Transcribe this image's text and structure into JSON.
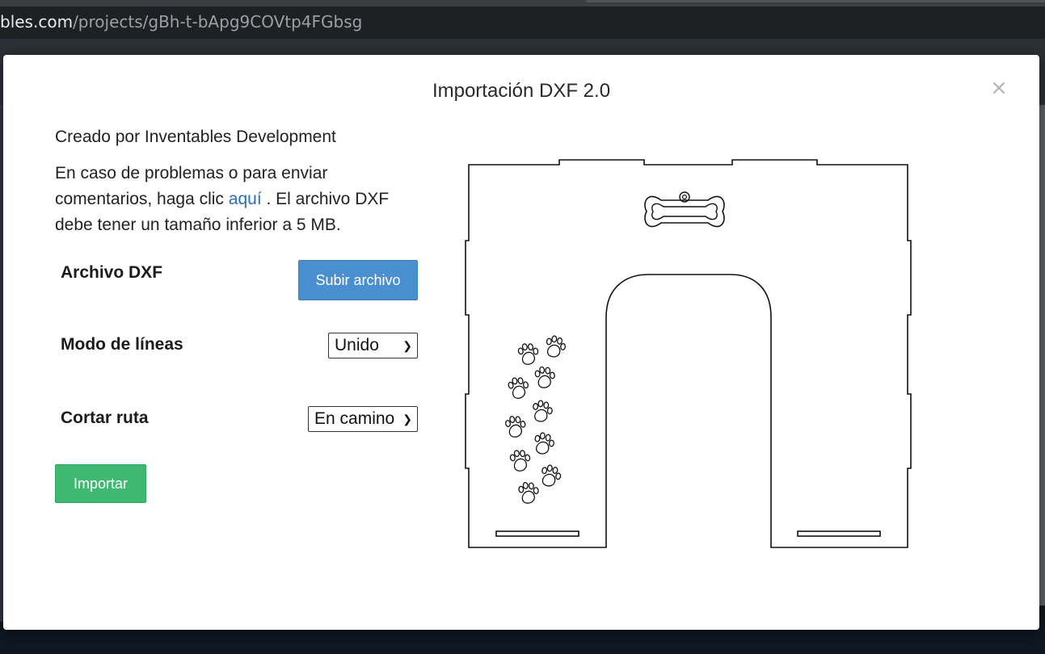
{
  "browser": {
    "url_host": "bles.com",
    "url_path": "/projects/gBh-t-bApg9COVtp4FGbsg"
  },
  "modal": {
    "title": "Importación DXF 2.0",
    "close_glyph": "×",
    "creator": "Creado por Inventables Development",
    "desc_before": "En caso de problemas o para enviar comentarios, haga clic ",
    "desc_link": "aquí",
    "desc_after": " . El archivo DXF debe tener un tamaño inferior a 5 MB.",
    "fields": {
      "file": {
        "label": "Archivo DXF",
        "button": "Subir archivo"
      },
      "line_mode": {
        "label": "Modo de líneas",
        "value": "Unido"
      },
      "cut_path": {
        "label": "Cortar ruta",
        "value": "En camino"
      }
    },
    "import_button": "Importar"
  },
  "icons": {
    "close": "close-icon",
    "chevron": "chevron-down-icon",
    "preview_bone": "bone-icon",
    "preview_paw": "paw-print-icon"
  },
  "colors": {
    "upload_button": "#4a90d0",
    "import_button": "#3fb872",
    "link": "#2a6ebb"
  }
}
